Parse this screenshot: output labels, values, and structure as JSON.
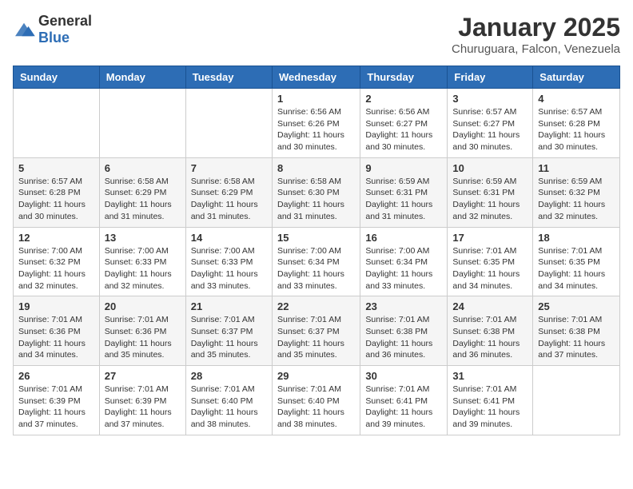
{
  "header": {
    "logo_general": "General",
    "logo_blue": "Blue",
    "month_title": "January 2025",
    "location": "Churuguara, Falcon, Venezuela"
  },
  "weekdays": [
    "Sunday",
    "Monday",
    "Tuesday",
    "Wednesday",
    "Thursday",
    "Friday",
    "Saturday"
  ],
  "weeks": [
    [
      {
        "day": "",
        "sunrise": "",
        "sunset": "",
        "daylight": ""
      },
      {
        "day": "",
        "sunrise": "",
        "sunset": "",
        "daylight": ""
      },
      {
        "day": "",
        "sunrise": "",
        "sunset": "",
        "daylight": ""
      },
      {
        "day": "1",
        "sunrise": "6:56 AM",
        "sunset": "6:26 PM",
        "daylight": "11 hours and 30 minutes."
      },
      {
        "day": "2",
        "sunrise": "6:56 AM",
        "sunset": "6:27 PM",
        "daylight": "11 hours and 30 minutes."
      },
      {
        "day": "3",
        "sunrise": "6:57 AM",
        "sunset": "6:27 PM",
        "daylight": "11 hours and 30 minutes."
      },
      {
        "day": "4",
        "sunrise": "6:57 AM",
        "sunset": "6:28 PM",
        "daylight": "11 hours and 30 minutes."
      }
    ],
    [
      {
        "day": "5",
        "sunrise": "6:57 AM",
        "sunset": "6:28 PM",
        "daylight": "11 hours and 30 minutes."
      },
      {
        "day": "6",
        "sunrise": "6:58 AM",
        "sunset": "6:29 PM",
        "daylight": "11 hours and 31 minutes."
      },
      {
        "day": "7",
        "sunrise": "6:58 AM",
        "sunset": "6:29 PM",
        "daylight": "11 hours and 31 minutes."
      },
      {
        "day": "8",
        "sunrise": "6:58 AM",
        "sunset": "6:30 PM",
        "daylight": "11 hours and 31 minutes."
      },
      {
        "day": "9",
        "sunrise": "6:59 AM",
        "sunset": "6:31 PM",
        "daylight": "11 hours and 31 minutes."
      },
      {
        "day": "10",
        "sunrise": "6:59 AM",
        "sunset": "6:31 PM",
        "daylight": "11 hours and 32 minutes."
      },
      {
        "day": "11",
        "sunrise": "6:59 AM",
        "sunset": "6:32 PM",
        "daylight": "11 hours and 32 minutes."
      }
    ],
    [
      {
        "day": "12",
        "sunrise": "7:00 AM",
        "sunset": "6:32 PM",
        "daylight": "11 hours and 32 minutes."
      },
      {
        "day": "13",
        "sunrise": "7:00 AM",
        "sunset": "6:33 PM",
        "daylight": "11 hours and 32 minutes."
      },
      {
        "day": "14",
        "sunrise": "7:00 AM",
        "sunset": "6:33 PM",
        "daylight": "11 hours and 33 minutes."
      },
      {
        "day": "15",
        "sunrise": "7:00 AM",
        "sunset": "6:34 PM",
        "daylight": "11 hours and 33 minutes."
      },
      {
        "day": "16",
        "sunrise": "7:00 AM",
        "sunset": "6:34 PM",
        "daylight": "11 hours and 33 minutes."
      },
      {
        "day": "17",
        "sunrise": "7:01 AM",
        "sunset": "6:35 PM",
        "daylight": "11 hours and 34 minutes."
      },
      {
        "day": "18",
        "sunrise": "7:01 AM",
        "sunset": "6:35 PM",
        "daylight": "11 hours and 34 minutes."
      }
    ],
    [
      {
        "day": "19",
        "sunrise": "7:01 AM",
        "sunset": "6:36 PM",
        "daylight": "11 hours and 34 minutes."
      },
      {
        "day": "20",
        "sunrise": "7:01 AM",
        "sunset": "6:36 PM",
        "daylight": "11 hours and 35 minutes."
      },
      {
        "day": "21",
        "sunrise": "7:01 AM",
        "sunset": "6:37 PM",
        "daylight": "11 hours and 35 minutes."
      },
      {
        "day": "22",
        "sunrise": "7:01 AM",
        "sunset": "6:37 PM",
        "daylight": "11 hours and 35 minutes."
      },
      {
        "day": "23",
        "sunrise": "7:01 AM",
        "sunset": "6:38 PM",
        "daylight": "11 hours and 36 minutes."
      },
      {
        "day": "24",
        "sunrise": "7:01 AM",
        "sunset": "6:38 PM",
        "daylight": "11 hours and 36 minutes."
      },
      {
        "day": "25",
        "sunrise": "7:01 AM",
        "sunset": "6:38 PM",
        "daylight": "11 hours and 37 minutes."
      }
    ],
    [
      {
        "day": "26",
        "sunrise": "7:01 AM",
        "sunset": "6:39 PM",
        "daylight": "11 hours and 37 minutes."
      },
      {
        "day": "27",
        "sunrise": "7:01 AM",
        "sunset": "6:39 PM",
        "daylight": "11 hours and 37 minutes."
      },
      {
        "day": "28",
        "sunrise": "7:01 AM",
        "sunset": "6:40 PM",
        "daylight": "11 hours and 38 minutes."
      },
      {
        "day": "29",
        "sunrise": "7:01 AM",
        "sunset": "6:40 PM",
        "daylight": "11 hours and 38 minutes."
      },
      {
        "day": "30",
        "sunrise": "7:01 AM",
        "sunset": "6:41 PM",
        "daylight": "11 hours and 39 minutes."
      },
      {
        "day": "31",
        "sunrise": "7:01 AM",
        "sunset": "6:41 PM",
        "daylight": "11 hours and 39 minutes."
      },
      {
        "day": "",
        "sunrise": "",
        "sunset": "",
        "daylight": ""
      }
    ]
  ],
  "labels": {
    "sunrise_prefix": "Sunrise: ",
    "sunset_prefix": "Sunset: ",
    "daylight_prefix": "Daylight: "
  }
}
